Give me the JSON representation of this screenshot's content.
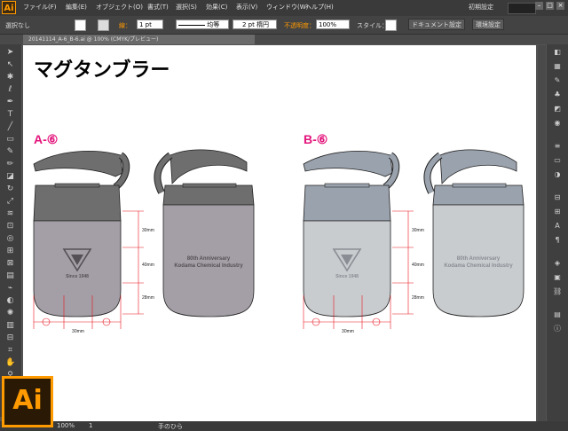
{
  "app": {
    "logo": "Ai"
  },
  "menu": [
    "ファイル(F)",
    "編集(E)",
    "オブジェクト(O)",
    "書式(T)",
    "選択(S)",
    "効果(C)",
    "表示(V)",
    "ウィンドウ(W)",
    "ヘルプ(H)"
  ],
  "workspace": {
    "preset": "初期設定"
  },
  "control": {
    "selection": "選択なし",
    "stroke_label": "線：",
    "stroke_weight": "1 pt",
    "line_style": "均等",
    "brush": "2 pt 楕円",
    "opacity_label": "不透明度：",
    "opacity": "100%",
    "style_label": "スタイル：",
    "doc_setup": "ドキュメント設定",
    "prefs": "環境設定"
  },
  "tab": {
    "title": "20141114_A-6_B-6.ai @ 100% (CMYK/プレビュー)"
  },
  "document": {
    "title": "マグタンブラー",
    "variants": [
      {
        "label": "A-⑥",
        "body_color": "#a49fa6",
        "cap_color": "#6e6e6e",
        "handle_color": "#6e6e6e",
        "text_color": "#555055"
      },
      {
        "label": "B-⑥",
        "body_color": "#c8cccf",
        "cap_color": "#9aa2ad",
        "handle_color": "#9aa2ad",
        "text_color": "#8a8e94"
      }
    ],
    "logo_text": "Since 1948",
    "anniversary_line1": "80th Anniversary",
    "anniversary_line2": "Kodama Chemical Industry",
    "dim_top": "30mm",
    "dim_mid": "40mm",
    "dim_bot": "28mm",
    "dim_width": "30mm"
  },
  "status": {
    "zoom": "100%",
    "page": "1",
    "tool": "手のひら"
  },
  "colors": {
    "accent": "#ff9a00",
    "dimension": "#e8141e",
    "label": "#e3147c"
  }
}
